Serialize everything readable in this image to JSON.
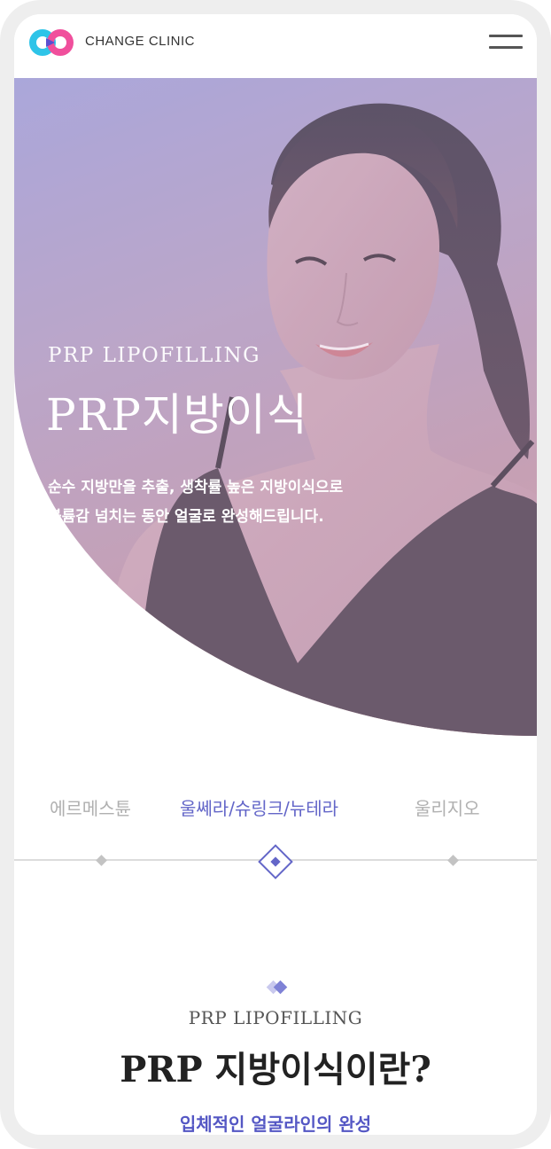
{
  "header": {
    "brand": "CHANGE CLINIC",
    "logo_colors": [
      "#2ec4e8",
      "#f04f9c",
      "#5a4fd0"
    ]
  },
  "hero": {
    "subtitle": "PRP LIPOFILLING",
    "title": "PRP지방이식",
    "description_line1": "순수 지방만을 추출, 생착률 높은 지방이식으로",
    "description_line2": "볼륨감 넘치는 동안 얼굴로 완성해드립니다."
  },
  "tabs": {
    "items": [
      {
        "label": "에르메스튠",
        "active": false
      },
      {
        "label": "울쎄라/슈링크/뉴테라",
        "active": true
      },
      {
        "label": "울리지오",
        "active": false
      }
    ]
  },
  "section": {
    "subtitle": "PRP LIPOFILLING",
    "title": "PRP 지방이식이란?",
    "lead": "입체적인 얼굴라인의 완성"
  },
  "colors": {
    "accent": "#6366c8",
    "tab_inactive": "#b0b0b0",
    "hero_gradient": [
      "#a8a8db",
      "#dca39d"
    ]
  }
}
